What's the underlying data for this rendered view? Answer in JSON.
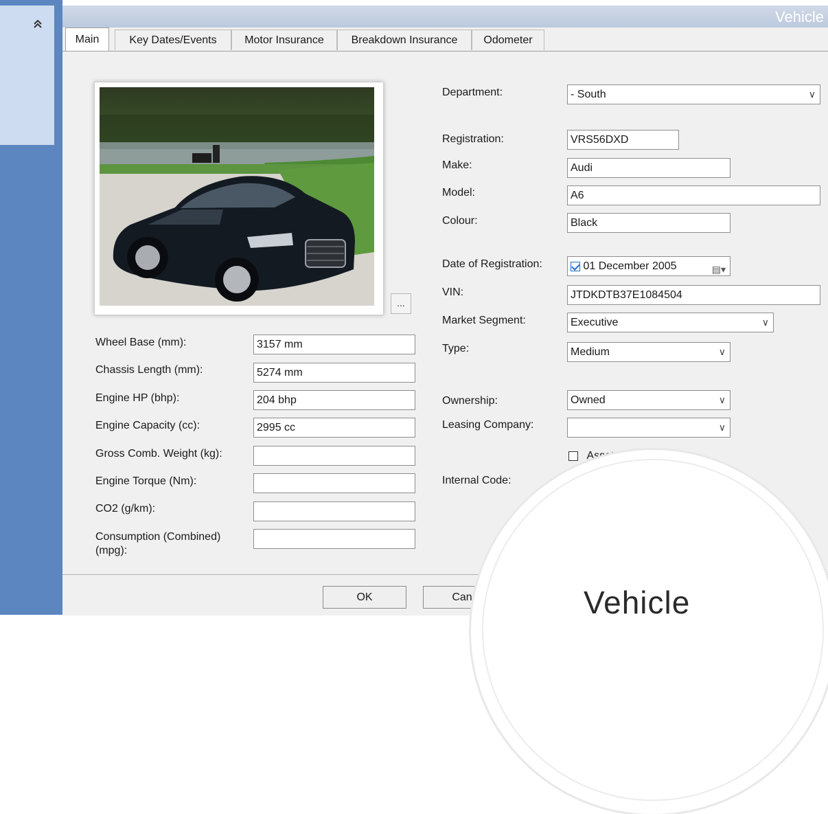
{
  "window": {
    "title": "Vehicle"
  },
  "sidebar": {
    "collapse_icon": "double-chevron-up-icon",
    "collapse_glyph": "˄˄"
  },
  "tabs": [
    {
      "label": "Main",
      "active": true
    },
    {
      "label": "Key Dates/Events",
      "active": false
    },
    {
      "label": "Motor Insurance",
      "active": false
    },
    {
      "label": "Breakdown Insurance",
      "active": false
    },
    {
      "label": "Odometer",
      "active": false
    }
  ],
  "photo": {
    "browse_label": "..."
  },
  "specs": {
    "wheel_base": {
      "label": "Wheel Base (mm):",
      "value": "3157 mm"
    },
    "chassis_length": {
      "label": "Chassis Length (mm):",
      "value": "5274 mm"
    },
    "engine_hp": {
      "label": "Engine HP (bhp):",
      "value": "204 bhp"
    },
    "engine_capacity": {
      "label": "Engine Capacity (cc):",
      "value": "2995 cc"
    },
    "gross_weight": {
      "label": "Gross Comb. Weight (kg):",
      "value": ""
    },
    "engine_torque": {
      "label": "Engine Torque (Nm):",
      "value": ""
    },
    "co2": {
      "label": "CO2 (g/km):",
      "value": ""
    },
    "consumption": {
      "label_line1": "Consumption (Combined)",
      "label_line2": "(mpg):",
      "value": ""
    }
  },
  "details": {
    "department": {
      "label": "Department:",
      "value": "- South"
    },
    "registration": {
      "label": "Registration:",
      "value": "VRS56DXD"
    },
    "make": {
      "label": "Make:",
      "value": "Audi"
    },
    "model": {
      "label": "Model:",
      "value": "A6"
    },
    "colour": {
      "label": "Colour:",
      "value": "Black"
    },
    "date_of_registration": {
      "label": "Date of Registration:",
      "value": "01 December 2005",
      "checked": true
    },
    "vin": {
      "label": "VIN:",
      "value": "JTDKDTB37E1084504"
    },
    "market_segment": {
      "label": "Market Segment:",
      "value": "Executive"
    },
    "type": {
      "label": "Type:",
      "value": "Medium"
    },
    "ownership": {
      "label": "Ownership:",
      "value": "Owned"
    },
    "leasing_company": {
      "label": "Leasing Company:",
      "value": ""
    },
    "asset": {
      "label": "Asset",
      "checked": false
    },
    "internal_code": {
      "label": "Internal Code:",
      "value": ""
    }
  },
  "footer": {
    "ok_label": "OK",
    "cancel_label": "Canc"
  },
  "overlay": {
    "caption": "Vehicle"
  }
}
